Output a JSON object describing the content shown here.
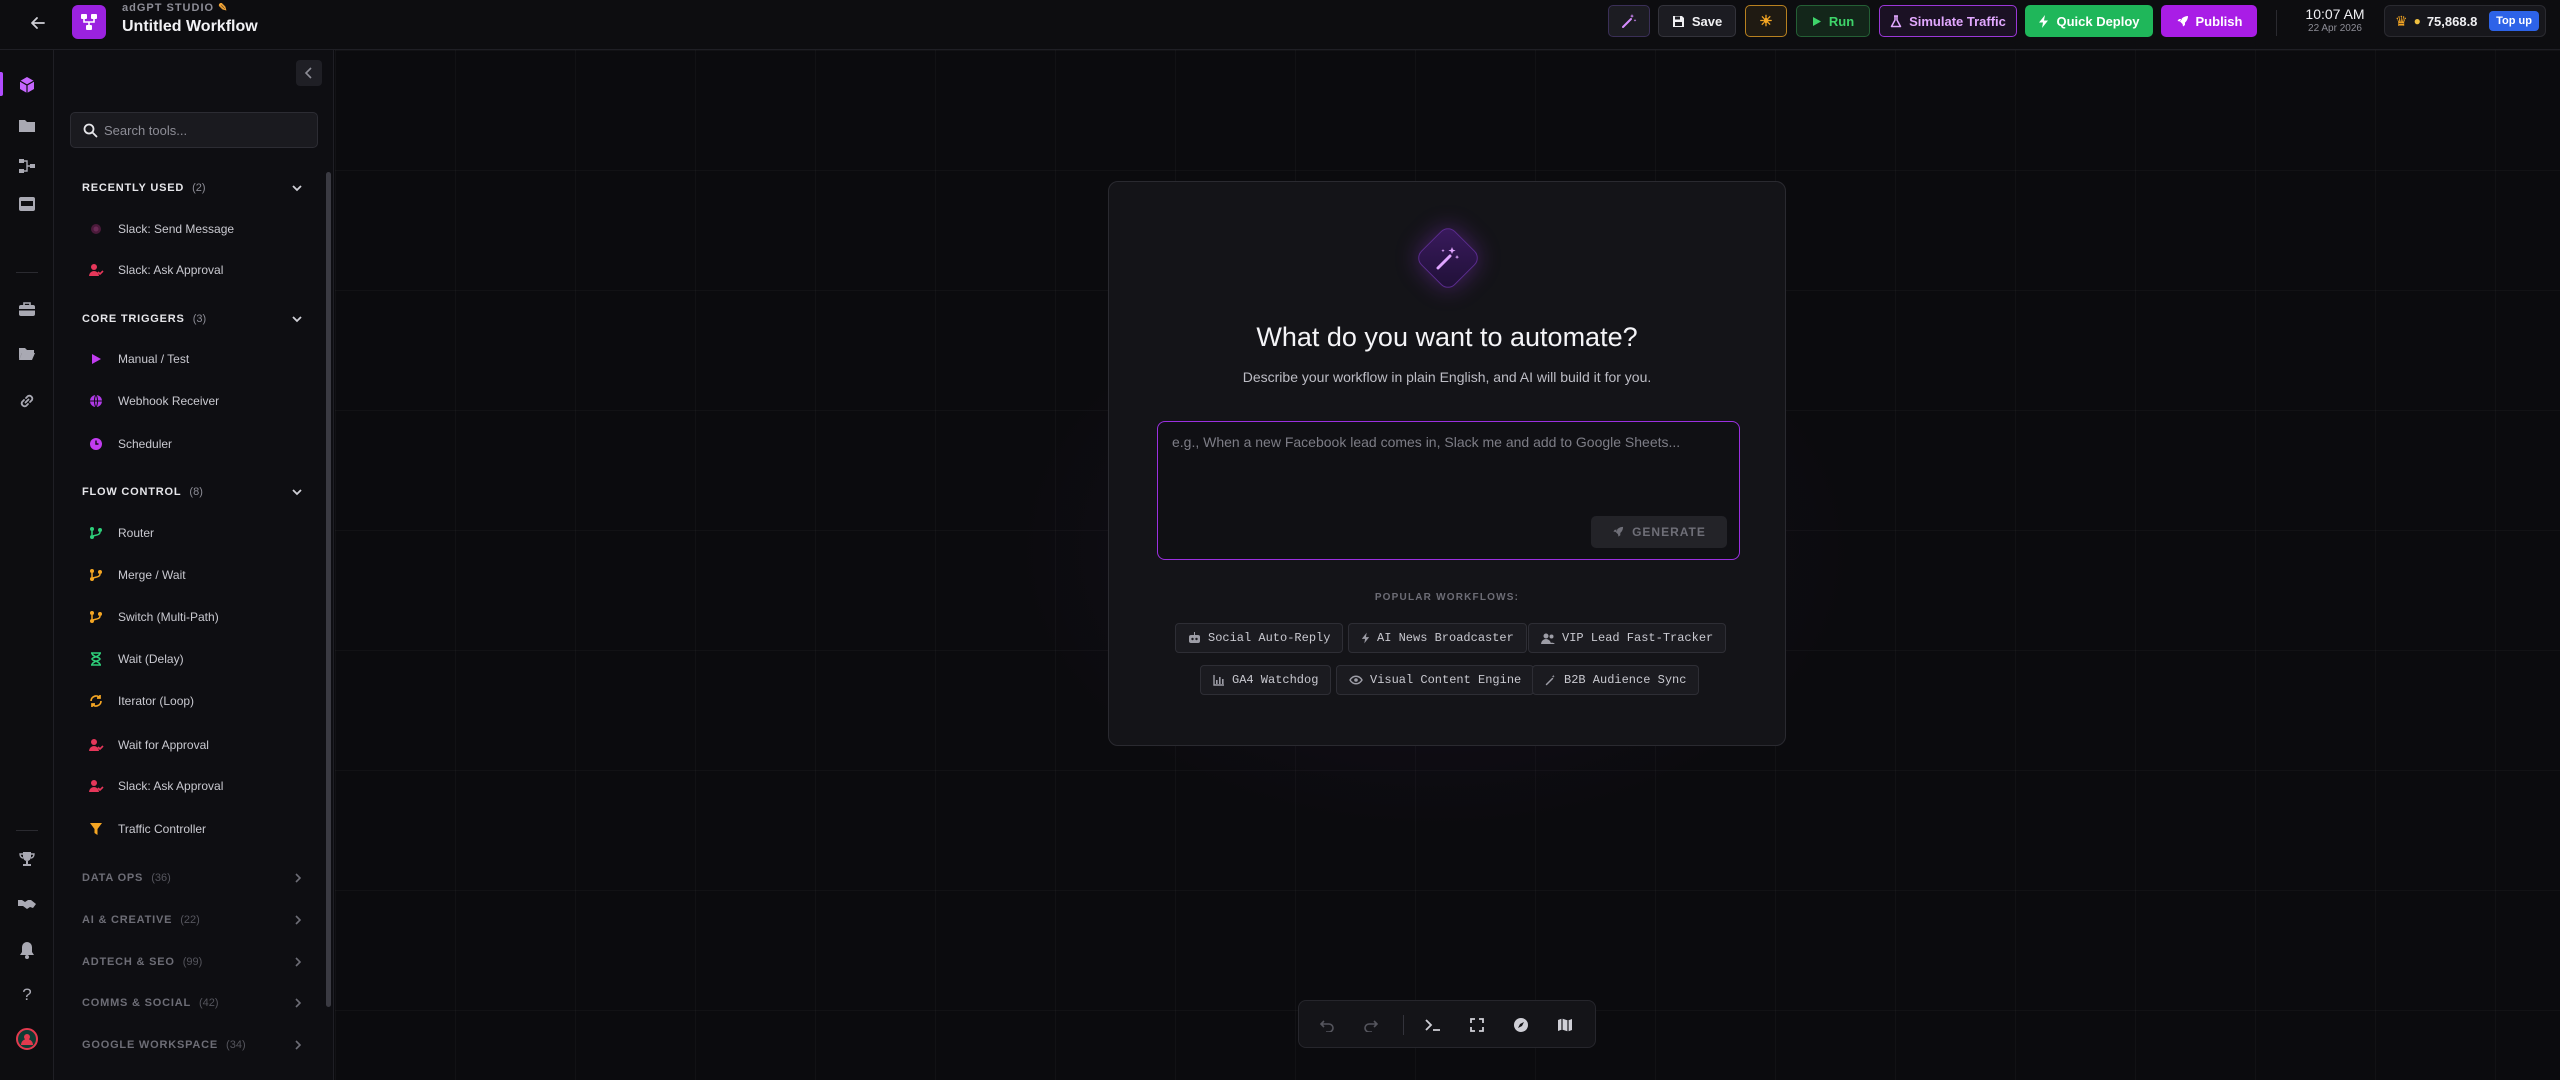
{
  "header": {
    "brand": "adGPT STUDIO",
    "workflow_title": "Untitled Workflow",
    "buttons": {
      "save": "Save",
      "run": "Run",
      "simulate": "Simulate Traffic",
      "quick_deploy": "Quick Deploy",
      "publish": "Publish"
    },
    "clock": {
      "time": "10:07 AM",
      "date": "22 Apr 2026"
    },
    "credits": {
      "amount": "75,868.8",
      "topup": "Top up"
    }
  },
  "panel": {
    "search_placeholder": "Search tools...",
    "sections": [
      {
        "name": "RECENTLY USED",
        "count": "(2)",
        "expanded": true,
        "items": [
          {
            "label": "Slack: Send Message",
            "icon": "slack-dot-icon"
          },
          {
            "label": "Slack: Ask Approval",
            "icon": "user-approval-icon"
          }
        ]
      },
      {
        "name": "CORE TRIGGERS",
        "count": "(3)",
        "expanded": true,
        "items": [
          {
            "label": "Manual / Test",
            "icon": "play-icon"
          },
          {
            "label": "Webhook Receiver",
            "icon": "globe-icon"
          },
          {
            "label": "Scheduler",
            "icon": "clock-icon"
          }
        ]
      },
      {
        "name": "FLOW CONTROL",
        "count": "(8)",
        "expanded": true,
        "items": [
          {
            "label": "Router",
            "icon": "branch-icon"
          },
          {
            "label": "Merge / Wait",
            "icon": "merge-icon"
          },
          {
            "label": "Switch (Multi-Path)",
            "icon": "switch-icon"
          },
          {
            "label": "Wait (Delay)",
            "icon": "hourglass-icon"
          },
          {
            "label": "Iterator (Loop)",
            "icon": "loop-icon"
          },
          {
            "label": "Wait for Approval",
            "icon": "user-approval-icon"
          },
          {
            "label": "Slack: Ask Approval",
            "icon": "user-approval-icon"
          },
          {
            "label": "Traffic Controller",
            "icon": "funnel-icon"
          }
        ]
      },
      {
        "name": "DATA OPS",
        "count": "(36)",
        "expanded": false
      },
      {
        "name": "AI & CREATIVE",
        "count": "(22)",
        "expanded": false
      },
      {
        "name": "ADTECH & SEO",
        "count": "(99)",
        "expanded": false
      },
      {
        "name": "COMMS & SOCIAL",
        "count": "(42)",
        "expanded": false
      },
      {
        "name": "GOOGLE WORKSPACE",
        "count": "(34)",
        "expanded": false
      }
    ]
  },
  "modal": {
    "title": "What do you want to automate?",
    "subtitle": "Describe your workflow in plain English, and AI will build it for you.",
    "prompt_placeholder": "e.g., When a new Facebook lead comes in, Slack me and add to Google Sheets...",
    "generate": "GENERATE",
    "popular_label": "POPULAR WORKFLOWS:",
    "chips": [
      {
        "label": "Social Auto-Reply",
        "icon": "robot-icon"
      },
      {
        "label": "AI News Broadcaster",
        "icon": "bolt-icon"
      },
      {
        "label": "VIP Lead Fast-Tracker",
        "icon": "users-icon"
      },
      {
        "label": "GA4 Watchdog",
        "icon": "chart-icon"
      },
      {
        "label": "Visual Content Engine",
        "icon": "eye-icon"
      },
      {
        "label": "B2B Audience Sync",
        "icon": "wand-icon"
      }
    ]
  },
  "colors": {
    "accent": "#a91de6",
    "success": "#1fb75a",
    "warning": "#f5a623",
    "topup": "#2d63e8"
  }
}
